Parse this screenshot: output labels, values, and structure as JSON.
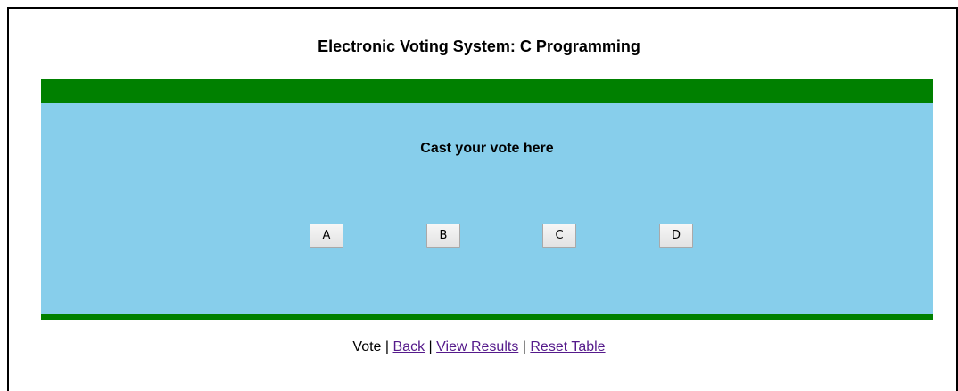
{
  "page": {
    "title": "Electronic Voting System: C Programming"
  },
  "panel": {
    "prompt": "Cast your vote here",
    "options": [
      "A",
      "B",
      "C",
      "D"
    ]
  },
  "nav": {
    "current": "Vote",
    "separator": " | ",
    "back_label": "Back",
    "view_results_label": "View Results",
    "reset_table_label": "Reset Table"
  },
  "colors": {
    "bar_green": "#008000",
    "panel_blue": "#87ceeb",
    "visited_link": "#551a8b"
  }
}
